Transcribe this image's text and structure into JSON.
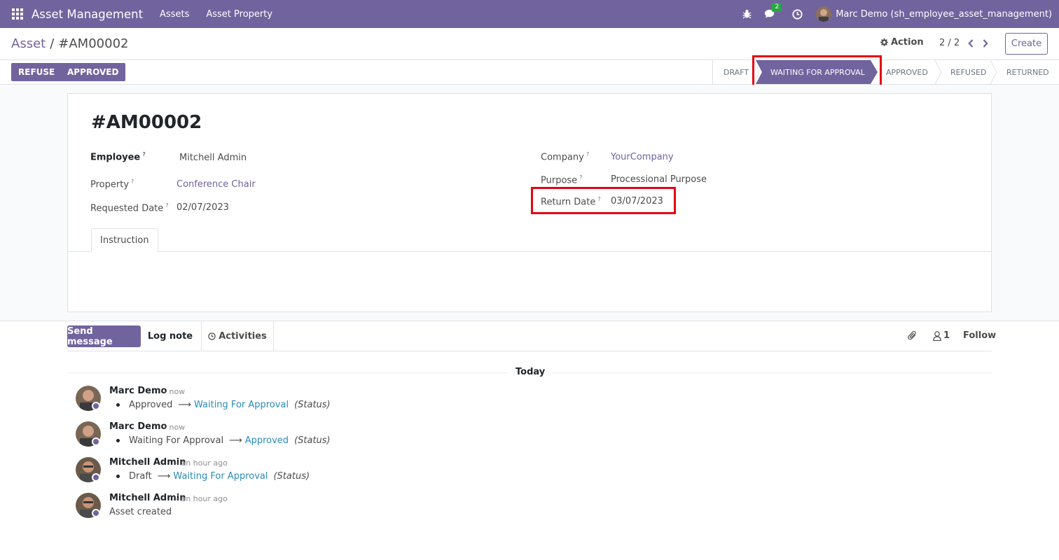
{
  "navbar": {
    "app_title": "Asset Management",
    "menus": [
      "Assets",
      "Asset Property"
    ],
    "messages_badge": "2",
    "user_name": "Marc Demo (sh_employee_asset_management)"
  },
  "control": {
    "breadcrumb_parent": "Asset",
    "breadcrumb_sep": "/",
    "breadcrumb_current": "#AM00002",
    "action_label": "Action",
    "pager": "2 / 2",
    "create_label": "Create"
  },
  "statusbar": {
    "buttons": [
      "REFUSE",
      "APPROVED"
    ],
    "stages": [
      "DRAFT",
      "WAITING FOR APPROVAL",
      "APPROVED",
      "REFUSED",
      "RETURNED"
    ],
    "active_stage": "WAITING FOR APPROVAL"
  },
  "form": {
    "title": "#AM00002",
    "employee_label": "Employee",
    "employee_value": "Mitchell Admin",
    "property_label": "Property",
    "property_value": "Conference Chair",
    "requested_date_label": "Requested Date",
    "requested_date_value": "02/07/2023",
    "company_label": "Company",
    "company_value": "YourCompany",
    "purpose_label": "Purpose",
    "purpose_value": "Processional Purpose",
    "return_date_label": "Return Date",
    "return_date_value": "03/07/2023",
    "help_mark": "?",
    "tab_label": "Instruction"
  },
  "chatter": {
    "send_message": "Send message",
    "log_note": "Log note",
    "activities": "Activities",
    "followers_count": "1",
    "follow": "Follow",
    "today": "Today",
    "arrow": "⟶",
    "field_label": "(Status)",
    "messages": [
      {
        "author": "Marc Demo",
        "time": "- now",
        "old": "Approved",
        "new": "Waiting For Approval"
      },
      {
        "author": "Marc Demo",
        "time": "- now",
        "old": "Waiting For Approval",
        "new": "Approved"
      },
      {
        "author": "Mitchell Admin",
        "time": "- an hour ago",
        "old": "Draft",
        "new": "Waiting For Approval"
      },
      {
        "author": "Mitchell Admin",
        "time": "- an hour ago",
        "text": "Asset created"
      }
    ]
  },
  "colors": {
    "brand": "#71639e",
    "highlight": "#e30613",
    "link": "#2a8ab5",
    "badge": "#28a745"
  }
}
